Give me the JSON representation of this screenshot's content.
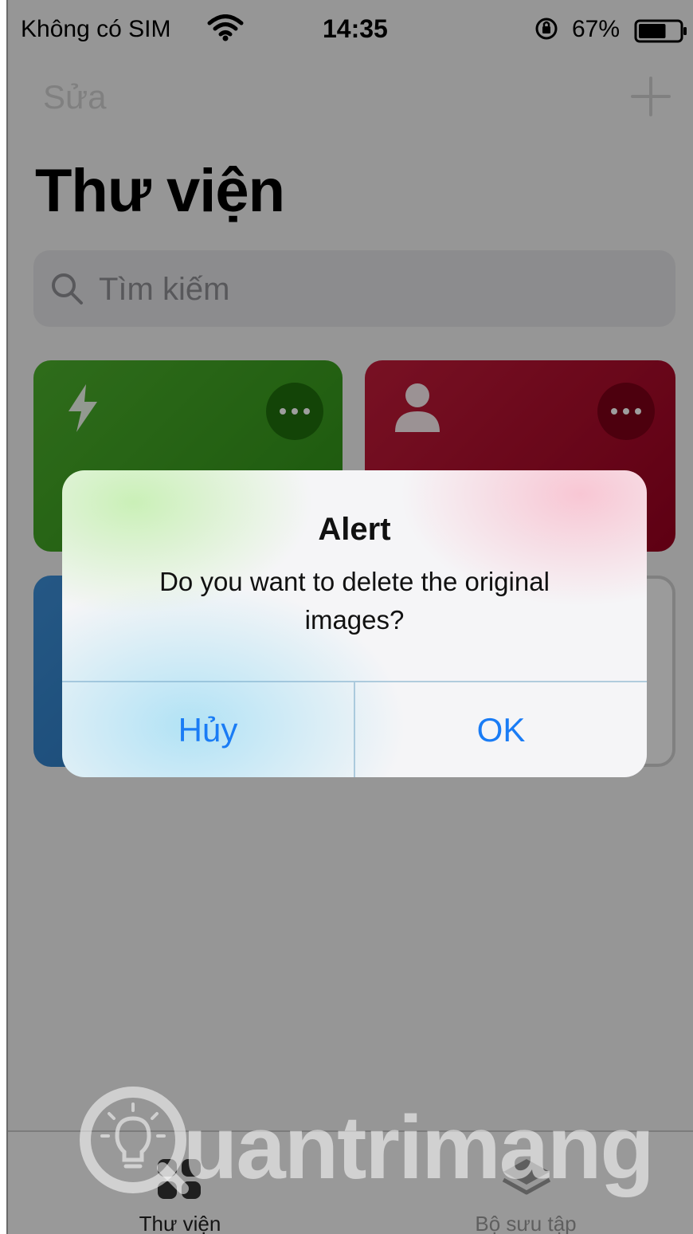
{
  "status_bar": {
    "carrier": "Không có SIM",
    "time": "14:35",
    "battery_percent": "67%",
    "battery_level": 0.67,
    "icons": [
      "wifi-icon",
      "orientation-lock-icon",
      "battery-icon"
    ]
  },
  "nav": {
    "edit_label": "Sửa",
    "add_icon": "plus-icon"
  },
  "page": {
    "title": "Thư viện"
  },
  "search": {
    "placeholder": "Tìm kiếm",
    "icon": "search-icon"
  },
  "cards": [
    {
      "color": "#3c9d1f",
      "icon": "bolt-icon",
      "more_icon": "more-icon"
    },
    {
      "color": "#b0102e",
      "icon": "person-icon",
      "more_icon": "more-icon"
    },
    {
      "color": "#2f7fc8"
    },
    {
      "color": "#fafafa"
    }
  ],
  "tabbar": {
    "items": [
      {
        "label": "Thư viện",
        "icon": "grid-icon"
      },
      {
        "label": "Bộ sưu tập",
        "icon": "layers-icon"
      }
    ]
  },
  "alert": {
    "title": "Alert",
    "message": "Do you want to delete the original images?",
    "cancel_label": "Hủy",
    "ok_label": "OK",
    "button_color": "#1a7cf5"
  },
  "watermark": {
    "text": "uantrimang"
  }
}
